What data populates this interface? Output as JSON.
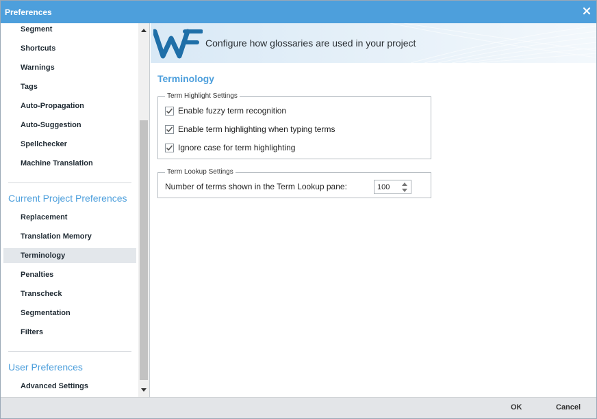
{
  "window": {
    "title": "Preferences"
  },
  "sidebar": {
    "general_items": [
      {
        "label": "Segment"
      },
      {
        "label": "Shortcuts"
      },
      {
        "label": "Warnings"
      },
      {
        "label": "Tags"
      },
      {
        "label": "Auto-Propagation"
      },
      {
        "label": "Auto-Suggestion"
      },
      {
        "label": "Spellchecker"
      },
      {
        "label": "Machine Translation"
      }
    ],
    "project_section": "Current Project Preferences",
    "project_items": [
      {
        "label": "Replacement"
      },
      {
        "label": "Translation Memory"
      },
      {
        "label": "Terminology",
        "selected": true
      },
      {
        "label": "Penalties"
      },
      {
        "label": "Transcheck"
      },
      {
        "label": "Segmentation"
      },
      {
        "label": "Filters"
      }
    ],
    "user_section": "User Preferences",
    "user_items": [
      {
        "label": "Advanced Settings"
      }
    ]
  },
  "banner": {
    "text": "Configure how glossaries are used in your project",
    "logo_icon": "wf-logo",
    "logo_color": "#1f6fa8"
  },
  "page": {
    "title": "Terminology"
  },
  "term_highlight": {
    "legend": "Term Highlight Settings",
    "options": [
      {
        "label": "Enable fuzzy term recognition",
        "checked": true
      },
      {
        "label": "Enable term highlighting when typing terms",
        "checked": true
      },
      {
        "label": "Ignore case for term highlighting",
        "checked": true
      }
    ]
  },
  "term_lookup": {
    "legend": "Term Lookup Settings",
    "count_label": "Number of terms shown in the Term Lookup pane:",
    "count_value": "100"
  },
  "footer": {
    "ok_label": "OK",
    "cancel_label": "Cancel"
  },
  "colors": {
    "titlebar": "#4d9fdc",
    "accent": "#4d9fdc",
    "footer": "#e3e5e8"
  }
}
